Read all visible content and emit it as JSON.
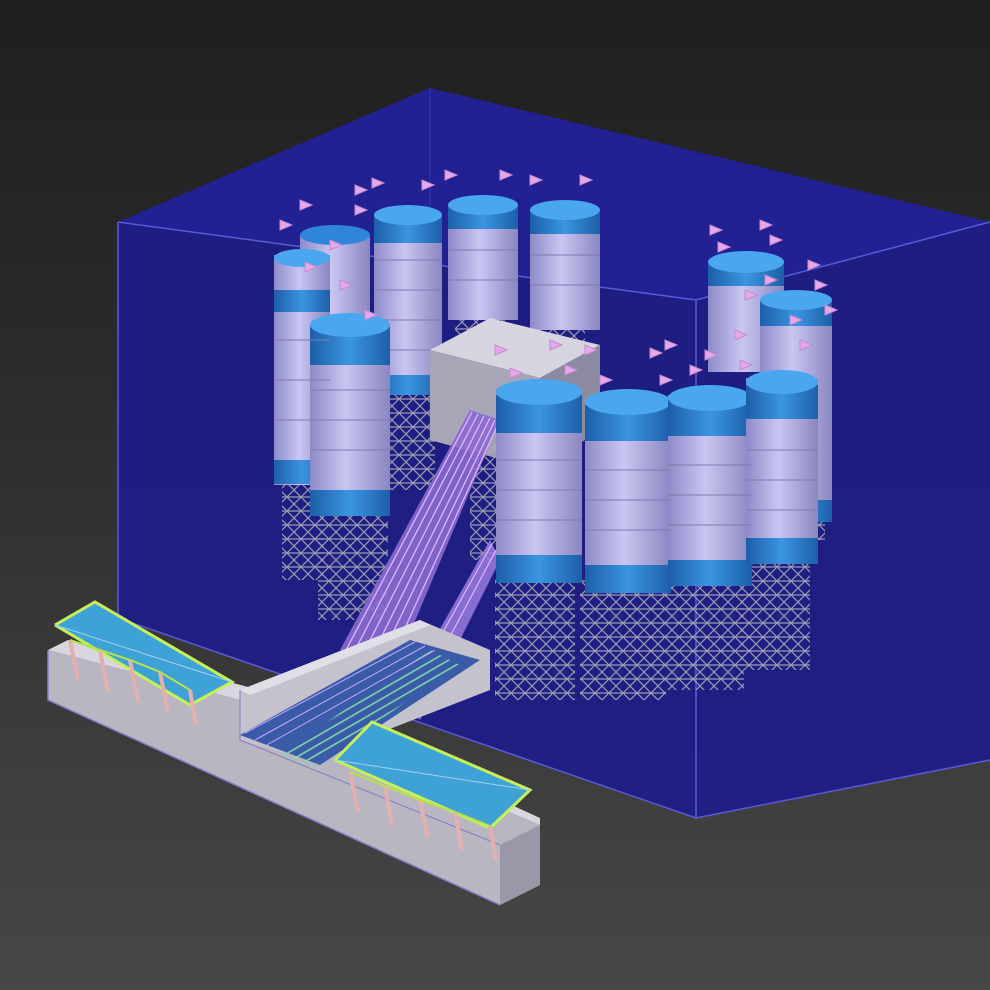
{
  "viewport": {
    "background_top": "#1f1f1f",
    "background_bottom": "#474747"
  },
  "scene": {
    "volume_color": "#1c1c8a",
    "silo_body_color": "#b4b0e4",
    "silo_band_color": "#2f86d8",
    "tower_color": "#8c8fa2",
    "gallery_color": "#c0bdcc",
    "trench_color": "#c8c6cf",
    "hopper_color": "#3ea2d6",
    "hopper_outline_color": "#c6f05a",
    "flag_color": "#e6a8e8",
    "conveyor_color": "#d9a0f0"
  }
}
